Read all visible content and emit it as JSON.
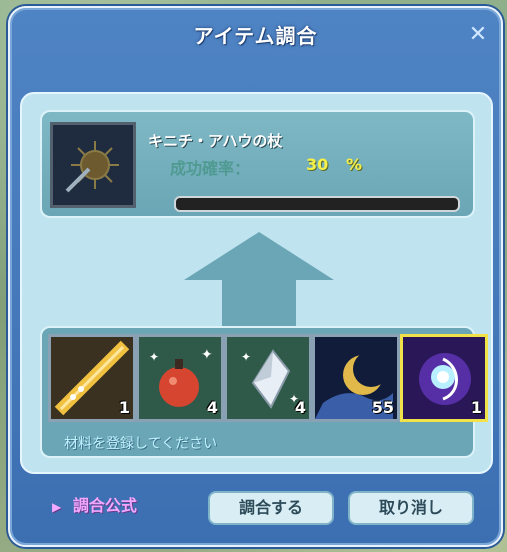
{
  "window": {
    "title": "アイテム調合",
    "close_icon": "close-icon"
  },
  "result": {
    "icon": "staff-icon",
    "name": "キニチ・アハウの杖",
    "success_rate_label": "成功確率：",
    "success_rate_value": "30",
    "success_rate_unit": "%",
    "progress_fraction": 0.0
  },
  "arrow_icon": "up-arrow-icon",
  "materials": {
    "slots": [
      {
        "icon": "golden-rod-icon",
        "count": "1",
        "selected": false
      },
      {
        "icon": "red-pouch-icon",
        "count": "4",
        "selected": false
      },
      {
        "icon": "crystal-shard-icon",
        "count": "4",
        "selected": false
      },
      {
        "icon": "crescent-moon-icon",
        "count": "55",
        "selected": false
      },
      {
        "icon": "glowing-orb-icon",
        "count": "1",
        "selected": true
      }
    ],
    "hint": "材料を登録してください"
  },
  "footer": {
    "formula_label": "調合公式",
    "craft_label": "調合する",
    "cancel_label": "取り消し"
  },
  "colors": {
    "window_blue": "#3c6fb1",
    "panel_teal": "#6aa6b5",
    "inner_light": "#bfe4f0",
    "rate_yellow": "#f5f04a",
    "formula_pink": "#f3a8ff",
    "selected_border": "#f2e24a"
  }
}
